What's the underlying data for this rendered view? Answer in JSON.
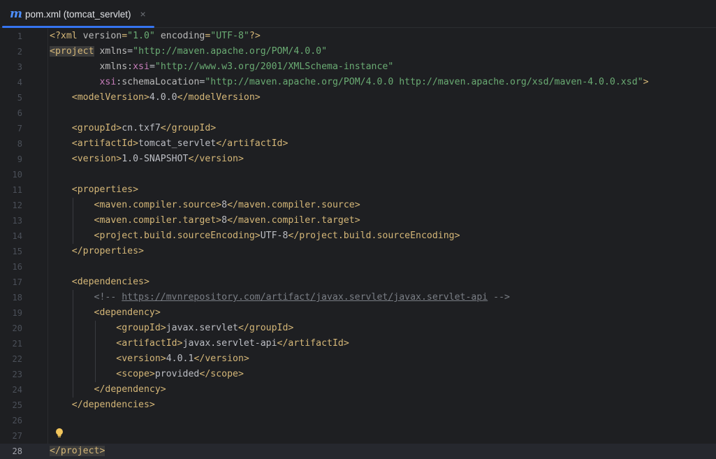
{
  "tab": {
    "label": "pom.xml (tomcat_servlet)",
    "icon": "m",
    "close": "×"
  },
  "colors": {
    "tag": "#d5b778",
    "attr": "#bababa",
    "namespace": "#c77dbb",
    "value": "#6aab73",
    "text": "#bcbec4",
    "comment": "#7a7e85",
    "accent": "#3574f0"
  },
  "current_line": 28,
  "lines": [
    {
      "n": "1",
      "tokens": [
        [
          "t-tag",
          "<?xml "
        ],
        [
          "t-attr",
          "version"
        ],
        [
          "t-tag",
          "="
        ],
        [
          "t-val",
          "\"1.0\""
        ],
        [
          "t-attr",
          " encoding"
        ],
        [
          "t-tag",
          "="
        ],
        [
          "t-val",
          "\"UTF-8\""
        ],
        [
          "t-tag",
          "?>"
        ]
      ]
    },
    {
      "n": "2",
      "tokens": [
        [
          "t-tag t-hl",
          "<project"
        ],
        [
          "t-attr",
          " xmlns"
        ],
        [
          "t-text",
          "="
        ],
        [
          "t-val",
          "\"http://maven.apache.org/POM/4.0.0\""
        ]
      ]
    },
    {
      "n": "3",
      "tokens": [
        [
          "t-attr",
          "         xmlns"
        ],
        [
          "t-text",
          ":"
        ],
        [
          "t-ns",
          "xsi"
        ],
        [
          "t-text",
          "="
        ],
        [
          "t-val",
          "\"http://www.w3.org/2001/XMLSchema-instance\""
        ]
      ]
    },
    {
      "n": "4",
      "tokens": [
        [
          "t-ns",
          "         xsi"
        ],
        [
          "t-text",
          ":"
        ],
        [
          "t-attr",
          "schemaLocation"
        ],
        [
          "t-text",
          "="
        ],
        [
          "t-val",
          "\"http://maven.apache.org/POM/4.0.0 http://maven.apache.org/xsd/maven-4.0.0.xsd\""
        ],
        [
          "t-tag",
          ">"
        ]
      ]
    },
    {
      "n": "5",
      "tokens": [
        [
          "t-tag",
          "    <modelVersion>"
        ],
        [
          "t-text",
          "4.0.0"
        ],
        [
          "t-tag",
          "</modelVersion>"
        ]
      ]
    },
    {
      "n": "6",
      "tokens": []
    },
    {
      "n": "7",
      "tokens": [
        [
          "t-tag",
          "    <groupId>"
        ],
        [
          "t-text",
          "cn.txf7"
        ],
        [
          "t-tag",
          "</groupId>"
        ]
      ]
    },
    {
      "n": "8",
      "tokens": [
        [
          "t-tag",
          "    <artifactId>"
        ],
        [
          "t-text",
          "tomcat_servlet"
        ],
        [
          "t-tag",
          "</artifactId>"
        ]
      ]
    },
    {
      "n": "9",
      "tokens": [
        [
          "t-tag",
          "    <version>"
        ],
        [
          "t-text",
          "1.0-SNAPSHOT"
        ],
        [
          "t-tag",
          "</version>"
        ]
      ]
    },
    {
      "n": "10",
      "tokens": []
    },
    {
      "n": "11",
      "tokens": [
        [
          "t-tag",
          "    <properties>"
        ]
      ]
    },
    {
      "n": "12",
      "tokens": [
        [
          "t-tag",
          "        <maven.compiler.source>"
        ],
        [
          "t-text",
          "8"
        ],
        [
          "t-tag",
          "</maven.compiler.source>"
        ]
      ]
    },
    {
      "n": "13",
      "tokens": [
        [
          "t-tag",
          "        <maven.compiler.target>"
        ],
        [
          "t-text",
          "8"
        ],
        [
          "t-tag",
          "</maven.compiler.target>"
        ]
      ]
    },
    {
      "n": "14",
      "tokens": [
        [
          "t-tag",
          "        <project.build.sourceEncoding>"
        ],
        [
          "t-text",
          "UTF-8"
        ],
        [
          "t-tag",
          "</project.build.sourceEncoding>"
        ]
      ]
    },
    {
      "n": "15",
      "tokens": [
        [
          "t-tag",
          "    </properties>"
        ]
      ]
    },
    {
      "n": "16",
      "tokens": []
    },
    {
      "n": "17",
      "tokens": [
        [
          "t-tag",
          "    <dependencies>"
        ]
      ]
    },
    {
      "n": "18",
      "tokens": [
        [
          "t-comment",
          "        <!-- "
        ],
        [
          "t-link",
          "https://mvnrepository.com/artifact/javax.servlet/javax.servlet-api"
        ],
        [
          "t-comment",
          " -->"
        ]
      ]
    },
    {
      "n": "19",
      "tokens": [
        [
          "t-tag",
          "        <dependency>"
        ]
      ]
    },
    {
      "n": "20",
      "tokens": [
        [
          "t-tag",
          "            <groupId>"
        ],
        [
          "t-text",
          "javax.servlet"
        ],
        [
          "t-tag",
          "</groupId>"
        ]
      ]
    },
    {
      "n": "21",
      "tokens": [
        [
          "t-tag",
          "            <artifactId>"
        ],
        [
          "t-text",
          "javax.servlet-api"
        ],
        [
          "t-tag",
          "</artifactId>"
        ]
      ]
    },
    {
      "n": "22",
      "tokens": [
        [
          "t-tag",
          "            <version>"
        ],
        [
          "t-text",
          "4.0.1"
        ],
        [
          "t-tag",
          "</version>"
        ]
      ]
    },
    {
      "n": "23",
      "tokens": [
        [
          "t-tag",
          "            <scope>"
        ],
        [
          "t-text",
          "provided"
        ],
        [
          "t-tag",
          "</scope>"
        ]
      ]
    },
    {
      "n": "24",
      "tokens": [
        [
          "t-tag",
          "        </dependency>"
        ]
      ]
    },
    {
      "n": "25",
      "tokens": [
        [
          "t-tag",
          "    </dependencies>"
        ]
      ]
    },
    {
      "n": "26",
      "tokens": []
    },
    {
      "n": "27",
      "tokens": []
    },
    {
      "n": "28",
      "tokens": [
        [
          "t-tag t-hl",
          "</project>"
        ]
      ]
    }
  ],
  "icons": {
    "file_type": "maven-m-icon",
    "intention": "lightbulb-icon"
  }
}
